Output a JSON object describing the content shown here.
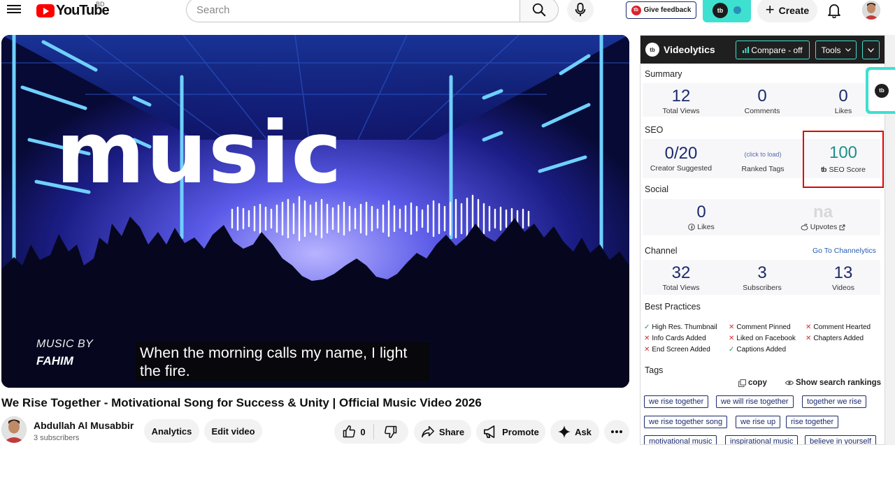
{
  "header": {
    "logo_text": "YouTube",
    "region": "BD",
    "search_placeholder": "Search",
    "feedback_label": "Give feedback",
    "feedback_logo": "tb",
    "tubebuddy_logo": "tb",
    "create_label": "Create",
    "icons": [
      "menu-icon",
      "search-icon",
      "mic-icon",
      "bell-icon",
      "plus-icon"
    ]
  },
  "video": {
    "overlay_title": "music",
    "music_by": "MUSIC BY",
    "music_by_name": "FAHIM",
    "caption": "When the morning calls my name, I light the fire.",
    "title": "We Rise Together - Motivational Song for Success & Unity | Official Music Video 2026"
  },
  "owner": {
    "name": "Abdullah Al Musabbir",
    "subscribers": "3 subscribers",
    "analytics_label": "Analytics",
    "edit_label": "Edit video"
  },
  "actions": {
    "like_count": "0",
    "share_label": "Share",
    "promote_label": "Promote",
    "ask_label": "Ask"
  },
  "videolytics": {
    "logo": "tb",
    "title": "Videolytics",
    "compare_label": "Compare - off",
    "tools_label": "Tools",
    "summary": {
      "label": "Summary",
      "stats": [
        {
          "value": "12",
          "label": "Total Views"
        },
        {
          "value": "0",
          "label": "Comments"
        },
        {
          "value": "0",
          "label": "Likes"
        }
      ]
    },
    "seo": {
      "label": "SEO",
      "creator_value": "0/20",
      "creator_label": "Creator Suggested",
      "ranked_link": "(click to load)",
      "ranked_label": "Ranked Tags",
      "score_value": "100",
      "score_logo": "tb",
      "score_label": "SEO Score"
    },
    "social": {
      "label": "Social",
      "likes_value": "0",
      "likes_label": "Likes",
      "upvotes_value": "na",
      "upvotes_label": "Upvotes"
    },
    "channel": {
      "label": "Channel",
      "link": "Go To Channelytics",
      "stats": [
        {
          "value": "32",
          "label": "Total Views"
        },
        {
          "value": "3",
          "label": "Subscribers"
        },
        {
          "value": "13",
          "label": "Videos"
        }
      ]
    },
    "best_practices": {
      "label": "Best Practices",
      "items": [
        {
          "text": "High Res. Thumbnail",
          "ok": true
        },
        {
          "text": "Comment Pinned",
          "ok": false
        },
        {
          "text": "Comment Hearted",
          "ok": false
        },
        {
          "text": "Info Cards Added",
          "ok": false
        },
        {
          "text": "Liked on Facebook",
          "ok": false
        },
        {
          "text": "Chapters Added",
          "ok": false
        },
        {
          "text": "End Screen Added",
          "ok": false
        },
        {
          "text": "Captions Added",
          "ok": true
        }
      ]
    },
    "tags": {
      "label": "Tags",
      "copy_label": "copy",
      "rankings_label": "Show search rankings",
      "items": [
        "we rise together",
        "we will rise together",
        "together we rise",
        "we rise together song",
        "we rise up",
        "rise together",
        "motivational music",
        "inspirational music",
        "believe in yourself"
      ]
    }
  },
  "side_tab_logo": "tb",
  "colors": {
    "youtube_red": "#ff0000",
    "tubebuddy_teal": "#3ee0d0",
    "stat_navy": "#1b2a6b",
    "seo_green": "#1f8f89",
    "highlight_red": "#e00000"
  }
}
